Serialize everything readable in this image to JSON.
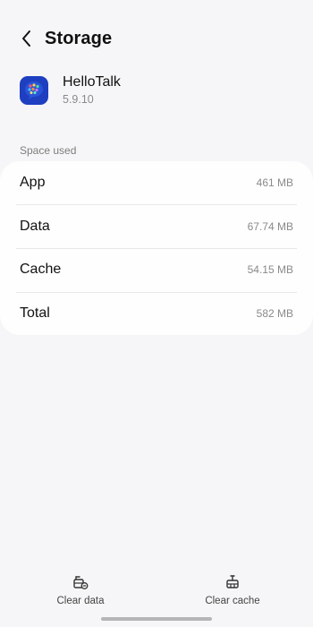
{
  "header": {
    "title": "Storage",
    "back_icon": "chevron-left-icon"
  },
  "app": {
    "name": "HelloTalk",
    "version": "5.9.10",
    "icon": "hellotalk-app-icon",
    "icon_color": "#1e3fc0"
  },
  "section": {
    "title": "Space used"
  },
  "storage": {
    "rows": [
      {
        "label": "App",
        "value": "461 MB"
      },
      {
        "label": "Data",
        "value": "67.74 MB"
      },
      {
        "label": "Cache",
        "value": "54.15 MB"
      },
      {
        "label": "Total",
        "value": "582 MB"
      }
    ]
  },
  "actions": {
    "clear_data": {
      "label": "Clear data",
      "icon": "clear-data-icon"
    },
    "clear_cache": {
      "label": "Clear cache",
      "icon": "clear-cache-icon"
    }
  },
  "colors": {
    "background": "#f6f6f8",
    "card": "#fefefe",
    "secondary_text": "#8a8a8a"
  }
}
